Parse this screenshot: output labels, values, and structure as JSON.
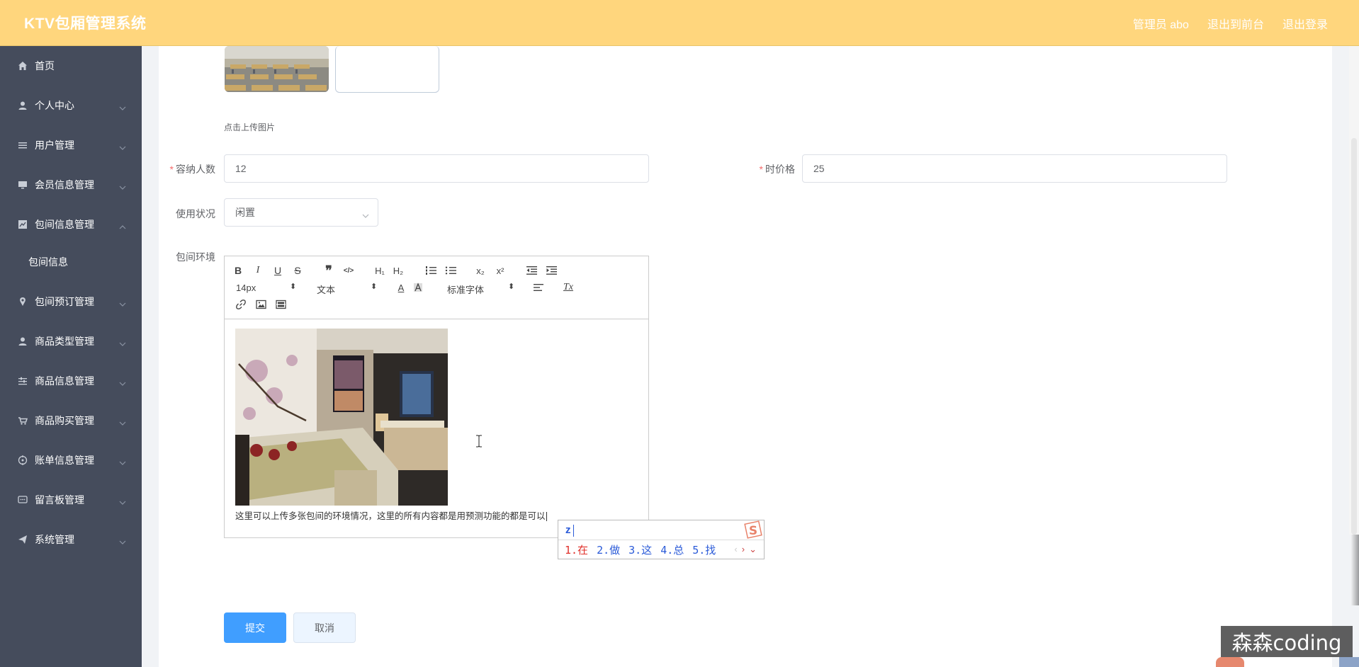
{
  "header": {
    "app_title": "KTV包厢管理系统",
    "admin_label": "管理员 abo",
    "back_to_front": "退出到前台",
    "logout": "退出登录"
  },
  "sidebar": {
    "items": [
      {
        "label": "首页",
        "icon": "home-icon"
      },
      {
        "label": "个人中心",
        "icon": "user-icon"
      },
      {
        "label": "用户管理",
        "icon": "list-icon"
      },
      {
        "label": "会员信息管理",
        "icon": "monitor-icon"
      },
      {
        "label": "包间信息管理",
        "icon": "chart-icon",
        "expanded": true
      },
      {
        "label": "包间预订管理",
        "icon": "location-icon"
      },
      {
        "label": "商品类型管理",
        "icon": "user-icon"
      },
      {
        "label": "商品信息管理",
        "icon": "sliders-icon"
      },
      {
        "label": "商品购买管理",
        "icon": "cart-icon"
      },
      {
        "label": "账单信息管理",
        "icon": "target-icon"
      },
      {
        "label": "留言板管理",
        "icon": "message-icon"
      },
      {
        "label": "系统管理",
        "icon": "send-icon"
      }
    ],
    "submenu": {
      "label": "包间信息"
    }
  },
  "form": {
    "upload_hint": "点击上传图片",
    "capacity_label": "容纳人数",
    "capacity_value": "12",
    "hourly_price_label": "时价格",
    "hourly_price_value": "25",
    "status_label": "使用状况",
    "status_value": "闲置",
    "environment_label": "包间环境"
  },
  "editor": {
    "font_size": "14px",
    "header_select": "文本",
    "font_family": "标准字体",
    "content_text": "这里可以上传多张包间的环境情况，这里的所有内容都是用预测功能的都是可以"
  },
  "ime": {
    "input": "z",
    "candidates": [
      "1.在",
      "2.做",
      "3.这",
      "4.总",
      "5.找"
    ]
  },
  "buttons": {
    "submit": "提交",
    "cancel": "取消"
  },
  "watermark": "森森coding",
  "colors": {
    "header_bg": "#ffd67d",
    "sidebar_bg": "#454c5c",
    "primary": "#409eff"
  }
}
